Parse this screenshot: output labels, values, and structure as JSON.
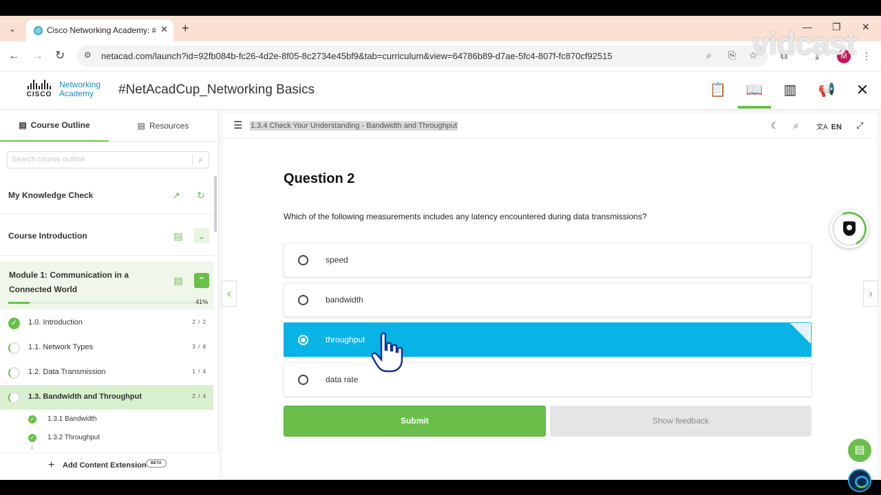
{
  "browser": {
    "tab_title": "Cisco Networking Academy: #N",
    "url": "netacad.com/launch?id=92fb084b-fc26-4d2e-8f05-8c2734e45bf9&tab=curriculum&view=64786b89-d7ae-5fc4-807f-fc870cf92515",
    "profile_initial": "M",
    "watermark": "vidcast"
  },
  "header": {
    "logo_word": "CISCO",
    "logo_text_line1": "Networking",
    "logo_text_line2": "Academy",
    "course_title": "#NetAcadCup_Networking Basics"
  },
  "sidebar": {
    "tabs": [
      {
        "label": "Course Outline",
        "icon": "book-icon",
        "active": true
      },
      {
        "label": "Resources",
        "icon": "document-icon",
        "active": false
      }
    ],
    "search_placeholder": "Search course outline",
    "knowledge_check": "My Knowledge Check",
    "course_intro": "Course Introduction",
    "module": {
      "title": "Module 1: Communication in a Connected World",
      "progress_pct": 41,
      "progress_label": "41%"
    },
    "topics": [
      {
        "label": "1.0. Introduction",
        "count": "2 / 2",
        "state": "done"
      },
      {
        "label": "1.1. Network Types",
        "count": "3 / 8",
        "state": "partial"
      },
      {
        "label": "1.2. Data Transmission",
        "count": "1 / 4",
        "state": "partial"
      },
      {
        "label": "1.3. Bandwidth and Throughput",
        "count": "2 / 4",
        "state": "current"
      }
    ],
    "subtopics": [
      {
        "label": "1.3.1 Bandwidth"
      },
      {
        "label": "1.3.2 Throughput"
      }
    ],
    "add_extension": "Add Content Extension",
    "beta_badge": "BETA"
  },
  "content": {
    "breadcrumb": "1.3.4 Check Your Understanding - Bandwidth and Throughput",
    "language": "EN",
    "question_title": "Question 2",
    "question_text": "Which of the following measurements includes any latency encountered during data transmissions?",
    "options": [
      {
        "label": "speed",
        "selected": false
      },
      {
        "label": "bandwidth",
        "selected": false
      },
      {
        "label": "throughput",
        "selected": true
      },
      {
        "label": "data rate",
        "selected": false
      }
    ],
    "submit_label": "Submit",
    "feedback_label": "Show feedback"
  },
  "colors": {
    "accent_green": "#6abf4b",
    "selected_blue": "#08b4e6",
    "link_blue": "#1a8bb8"
  }
}
